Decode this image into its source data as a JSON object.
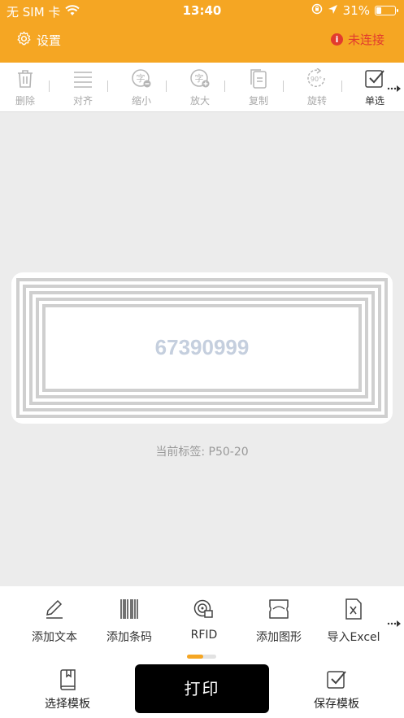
{
  "status_bar": {
    "carrier": "无 SIM 卡",
    "time": "13:40",
    "battery": "31%",
    "battery_level": 0.31
  },
  "nav": {
    "settings_label": "设置",
    "connection_status": "未连接"
  },
  "toolbar": {
    "items": [
      {
        "label": "删除",
        "icon": "trash-icon"
      },
      {
        "label": "对齐",
        "icon": "align-icon"
      },
      {
        "label": "缩小",
        "icon": "text-shrink-icon"
      },
      {
        "label": "放大",
        "icon": "text-enlarge-icon"
      },
      {
        "label": "复制",
        "icon": "copy-icon"
      },
      {
        "label": "旋转",
        "icon": "rotate-icon"
      },
      {
        "label": "单选",
        "icon": "checkbox-icon"
      }
    ]
  },
  "canvas": {
    "barcode_value": "67390999",
    "current_label": "当前标签:  P50-20"
  },
  "add_menu": {
    "items": [
      {
        "label": "添加文本",
        "icon": "pen-icon"
      },
      {
        "label": "添加条码",
        "icon": "barcode-icon"
      },
      {
        "label": "RFID",
        "icon": "rfid-icon"
      },
      {
        "label": "添加图形",
        "icon": "shape-icon"
      },
      {
        "label": "导入Excel",
        "icon": "excel-icon"
      }
    ]
  },
  "bottom_actions": {
    "select_template": "选择模板",
    "print": "打印",
    "save_template": "保存模板"
  },
  "colors": {
    "accent": "#f5a623",
    "error": "#e23b2e",
    "print_button": "#000000"
  }
}
